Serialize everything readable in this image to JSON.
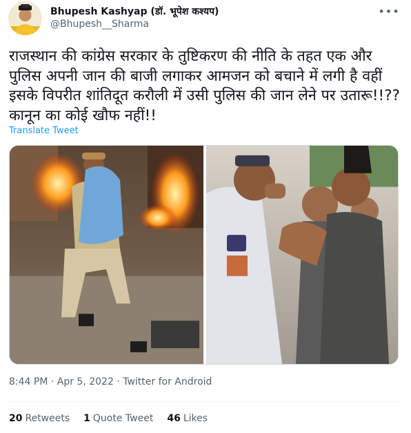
{
  "author": {
    "name": "Bhupesh Kashyap (डॉ. भूपेश कश्यप)",
    "handle": "@Bhupesh__Sharma"
  },
  "more_icon": "more-horizontal-icon",
  "tweet": {
    "text": "राजस्थान की कांग्रेस सरकार के तुष्टिकरण की नीति के तहत एक और पुलिस अपनी जान की बाजी लगाकर आमजन को बचाने में लगी है वहीं इसके विपरीत शांतिदूत करौली में उसी पुलिस की जान लेने पर उतारू!!?? कानून का कोई खौफ नहीं!!",
    "translate_label": "Translate Tweet"
  },
  "meta": {
    "time": "8:44 PM",
    "date": "Apr 5, 2022",
    "source": "Twitter for Android",
    "line": "8:44 PM · Apr 5, 2022 · Twitter for Android"
  },
  "stats": {
    "retweets_count": "20",
    "retweets_label": "Retweets",
    "quotes_count": "1",
    "quotes_label": "Quote Tweet",
    "likes_count": "46",
    "likes_label": "Likes"
  },
  "colors": {
    "text": "#0f1419",
    "secondary": "#536471",
    "link": "#1d9bf0",
    "border": "#cfd9de"
  }
}
